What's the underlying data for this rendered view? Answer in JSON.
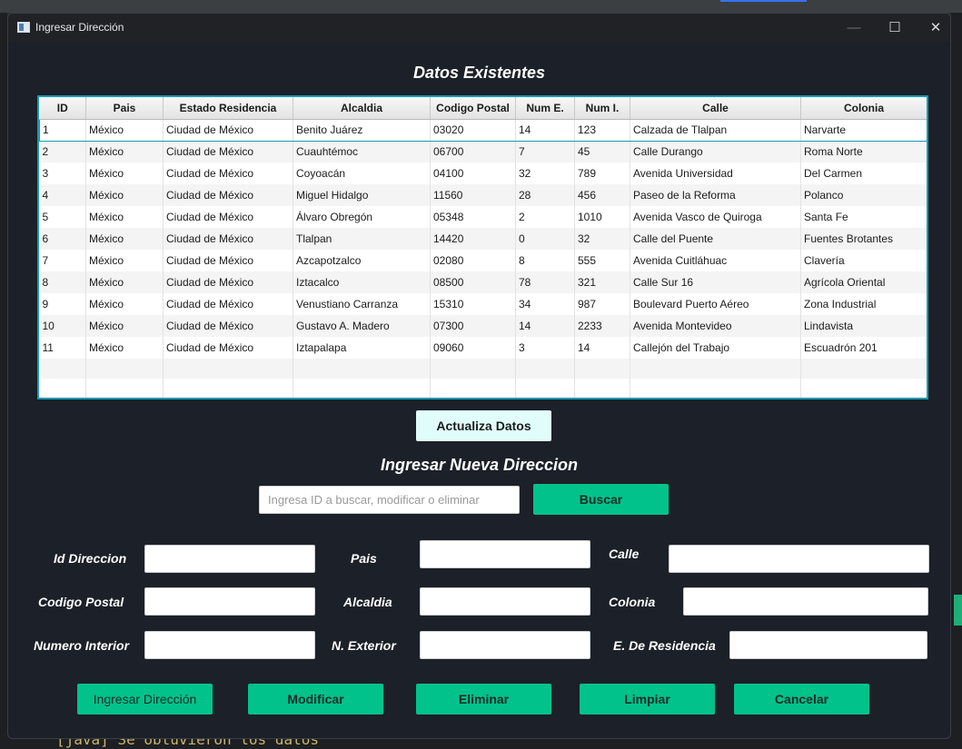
{
  "background": {
    "console_text": "[java] Se obtuvieron los datos"
  },
  "window": {
    "title": "Ingresar Dirección",
    "controls": {
      "minimize": "—",
      "maximize": "☐",
      "close": "✕"
    }
  },
  "existing": {
    "heading": "Datos Existentes",
    "columns": [
      "ID",
      "Pais",
      "Estado Residencia",
      "Alcaldia",
      "Codigo Postal",
      "Num E.",
      "Num I.",
      "Calle",
      "Colonia"
    ],
    "rows": [
      [
        "1",
        "México",
        "Ciudad de México",
        "Benito Juárez",
        "03020",
        "14",
        "123",
        "Calzada de Tlalpan",
        "Narvarte"
      ],
      [
        "2",
        "México",
        "Ciudad de México",
        "Cuauhtémoc",
        "06700",
        "7",
        "45",
        "Calle Durango",
        "Roma Norte"
      ],
      [
        "3",
        "México",
        "Ciudad de México",
        "Coyoacán",
        "04100",
        "32",
        "789",
        "Avenida Universidad",
        "Del Carmen"
      ],
      [
        "4",
        "México",
        "Ciudad de México",
        "Miguel Hidalgo",
        "11560",
        "28",
        "456",
        "Paseo de la Reforma",
        "Polanco"
      ],
      [
        "5",
        "México",
        "Ciudad de México",
        "Álvaro Obregón",
        "05348",
        "2",
        "1010",
        "Avenida Vasco de Quiroga",
        "Santa Fe"
      ],
      [
        "6",
        "México",
        "Ciudad de México",
        "Tlalpan",
        "14420",
        "0",
        "32",
        "Calle del Puente",
        "Fuentes Brotantes"
      ],
      [
        "7",
        "México",
        "Ciudad de México",
        "Azcapotzalco",
        "02080",
        "8",
        "555",
        "Avenida Cuitláhuac",
        "Clavería"
      ],
      [
        "8",
        "México",
        "Ciudad de México",
        "Iztacalco",
        "08500",
        "78",
        "321",
        "Calle Sur 16",
        "Agrícola Oriental"
      ],
      [
        "9",
        "México",
        "Ciudad de México",
        "Venustiano Carranza",
        "15310",
        "34",
        "987",
        "Boulevard Puerto Aéreo",
        "Zona Industrial"
      ],
      [
        "10",
        "México",
        "Ciudad de México",
        "Gustavo A. Madero",
        "07300",
        "14",
        "2233",
        "Avenida Montevideo",
        "Lindavista"
      ],
      [
        "11",
        "México",
        "Ciudad de México",
        "Iztapalapa",
        "09060",
        "3",
        "14",
        "Callejón del Trabajo",
        "Escuadrón 201"
      ]
    ],
    "refresh_label": "Actualiza Datos"
  },
  "form": {
    "heading": "Ingresar Nueva Direccion",
    "search": {
      "placeholder": "Ingresa ID a buscar, modificar o eliminar",
      "value": "",
      "button": "Buscar"
    },
    "labels": {
      "id": "Id Direccion",
      "pais": "Pais",
      "calle": "Calle",
      "codigo_postal": "Codigo Postal",
      "alcaldia": "Alcaldia",
      "colonia": "Colonia",
      "numero_interior": "Numero Interior",
      "numero_exterior": "N. Exterior",
      "estado": "E. De Residencia"
    },
    "values": {
      "id": "",
      "pais": "",
      "calle": "",
      "codigo_postal": "",
      "alcaldia": "",
      "colonia": "",
      "numero_interior": "",
      "numero_exterior": "",
      "estado": ""
    },
    "actions": {
      "ingresar": "Ingresar Dirección",
      "modificar": "Modificar",
      "eliminar": "Eliminar",
      "limpiar": "Limpiar",
      "cancelar": "Cancelar"
    }
  },
  "colors": {
    "window_bg": "#1c2028",
    "accent_green": "#00c28a",
    "table_border": "#1a9bb3",
    "refresh_button": "#e0fdfc"
  }
}
